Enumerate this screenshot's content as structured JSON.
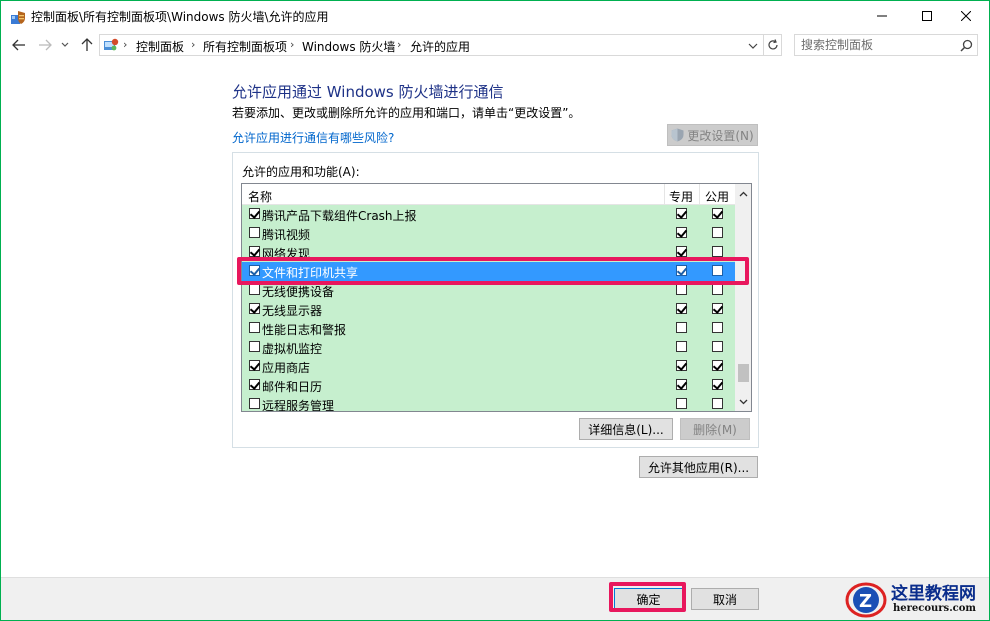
{
  "window": {
    "title": "控制面板\\所有控制面板项\\Windows 防火墙\\允许的应用"
  },
  "address": {
    "crumbs": [
      "控制面板",
      "所有控制面板项",
      "Windows 防火墙",
      "允许的应用"
    ],
    "search_placeholder": "搜索控制面板"
  },
  "content": {
    "heading": "允许应用通过 Windows 防火墙进行通信",
    "subtext": "若要添加、更改或删除所允许的应用和端口，请单击“更改设置”。",
    "risk_link": "允许应用进行通信有哪些风险?",
    "change_settings_label": "更改设置(N)",
    "list_label": "允许的应用和功能(A):",
    "columns": {
      "name": "名称",
      "private": "专用",
      "public": "公用"
    },
    "rows": [
      {
        "label": "腾讯产品下载组件Crash上报",
        "enabled": true,
        "private": true,
        "public": true,
        "selected": false
      },
      {
        "label": "腾讯视频",
        "enabled": false,
        "private": true,
        "public": false,
        "selected": false
      },
      {
        "label": "网络发现",
        "enabled": true,
        "private": true,
        "public": false,
        "selected": false
      },
      {
        "label": "文件和打印机共享",
        "enabled": true,
        "private": true,
        "public": false,
        "selected": true
      },
      {
        "label": "无线便携设备",
        "enabled": false,
        "private": false,
        "public": false,
        "selected": false
      },
      {
        "label": "无线显示器",
        "enabled": true,
        "private": true,
        "public": true,
        "selected": false
      },
      {
        "label": "性能日志和警报",
        "enabled": false,
        "private": false,
        "public": false,
        "selected": false
      },
      {
        "label": "虚拟机监控",
        "enabled": false,
        "private": false,
        "public": false,
        "selected": false
      },
      {
        "label": "应用商店",
        "enabled": true,
        "private": true,
        "public": true,
        "selected": false
      },
      {
        "label": "邮件和日历",
        "enabled": true,
        "private": true,
        "public": true,
        "selected": false
      },
      {
        "label": "远程服务管理",
        "enabled": false,
        "private": false,
        "public": false,
        "selected": false
      }
    ],
    "details_label": "详细信息(L)...",
    "remove_label": "删除(M)",
    "allow_other_label": "允许其他应用(R)..."
  },
  "footer": {
    "ok_label": "确定",
    "cancel_label": "取消"
  },
  "watermark": {
    "title": "这里教程网",
    "url": "herecours.com"
  },
  "colors": {
    "desktop_green": "#00b050",
    "list_green": "#c6efce",
    "selection_blue": "#3399ff",
    "highlight_pink": "#e8175d",
    "heading_blue": "#1e3287",
    "link_blue": "#0066cc"
  }
}
